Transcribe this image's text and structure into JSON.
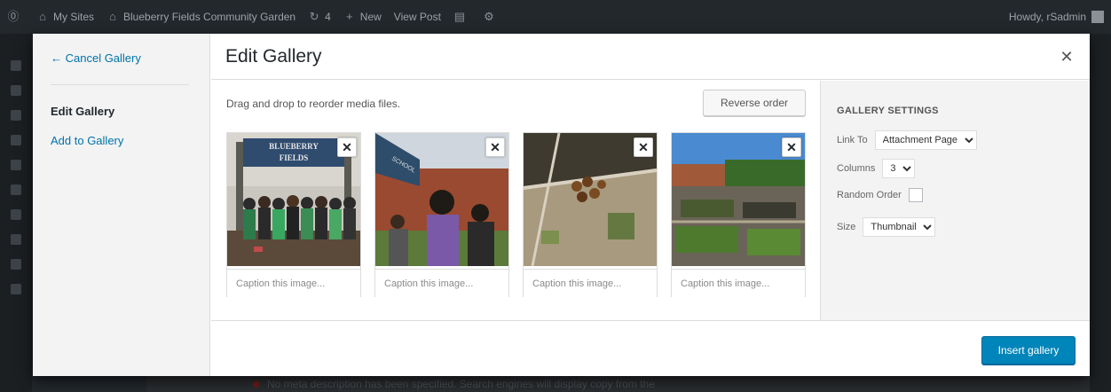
{
  "adminbar": {
    "my_sites": "My Sites",
    "site_name": "Blueberry Fields Community Garden",
    "updates_count": "4",
    "new_label": "New",
    "view_post": "View Post",
    "howdy": "Howdy, rSadmin"
  },
  "menu": {
    "cancel_gallery": "← Cancel Gallery",
    "edit_gallery": "Edit Gallery",
    "add_to_gallery": "Add to Gallery"
  },
  "modal": {
    "title": "Edit Gallery",
    "close_icon": "close-icon"
  },
  "content": {
    "instructions": "Drag and drop to reorder media files.",
    "reverse_order": "Reverse order",
    "images": [
      {
        "caption_placeholder": "Caption this image...",
        "subject": "group of people under 'Blueberry Fields' sign"
      },
      {
        "caption_placeholder": "Caption this image...",
        "subject": "people near school building"
      },
      {
        "caption_placeholder": "Caption this image...",
        "subject": "garden bed with mulch"
      },
      {
        "caption_placeholder": "Caption this image...",
        "subject": "raised garden beds"
      }
    ]
  },
  "settings": {
    "heading": "Gallery Settings",
    "link_to_label": "Link To",
    "link_to_value": "Attachment Page",
    "columns_label": "Columns",
    "columns_value": "3",
    "random_order_label": "Random Order",
    "size_label": "Size",
    "size_value": "Thumbnail"
  },
  "toolbar": {
    "insert_gallery": "Insert gallery"
  },
  "background_notice": "No meta description has been specified. Search engines will display copy from the"
}
